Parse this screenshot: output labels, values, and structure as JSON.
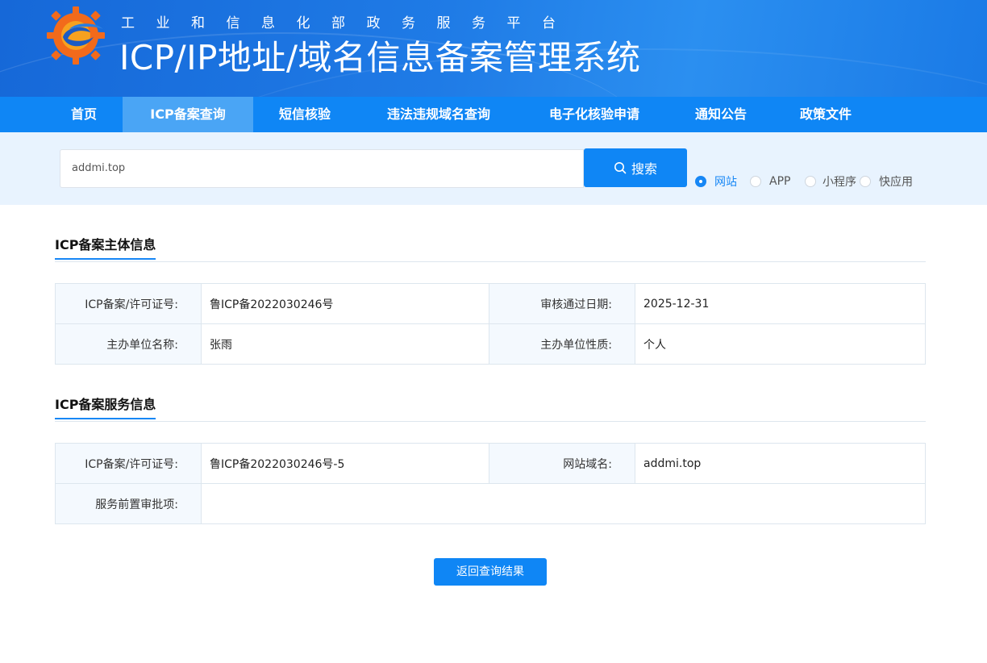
{
  "header": {
    "subtitle": "工业和信息化部政务服务平台",
    "title": "ICP/IP地址/域名信息备案管理系统"
  },
  "nav": {
    "items": [
      "首页",
      "ICP备案查询",
      "短信核验",
      "违法违规域名查询",
      "电子化核验申请",
      "通知公告",
      "政策文件"
    ],
    "active": "ICP备案查询"
  },
  "search": {
    "value": "addmi.top",
    "button_label": "搜索",
    "types": [
      "网站",
      "APP",
      "小程序",
      "快应用"
    ],
    "selected_type": "网站"
  },
  "subject_section": {
    "title": "ICP备案主体信息",
    "rows": [
      {
        "label1": "ICP备案/许可证号:",
        "value1": "鲁ICP备2022030246号",
        "label2": "审核通过日期:",
        "value2": "2025-12-31"
      },
      {
        "label1": "主办单位名称:",
        "value1": "张雨",
        "label2": "主办单位性质:",
        "value2": "个人"
      }
    ]
  },
  "service_section": {
    "title": "ICP备案服务信息",
    "license_label": "ICP备案/许可证号:",
    "license_value": "鲁ICP备2022030246号-5",
    "domain_label": "网站域名:",
    "domain_value": "addmi.top",
    "approval_label": "服务前置审批项:",
    "approval_value": ""
  },
  "back_button_label": "返回查询结果",
  "colors": {
    "primary": "#0f86f5",
    "nav_active": "#4aa5f5",
    "search_band": "#e8f3fe"
  }
}
